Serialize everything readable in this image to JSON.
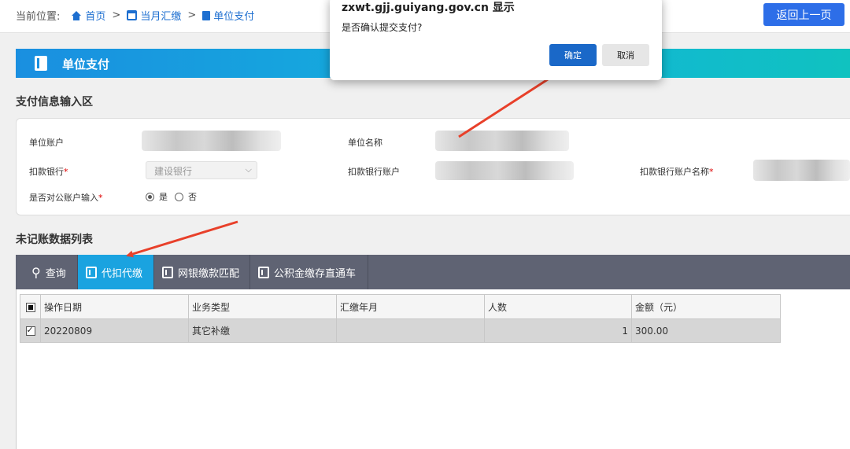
{
  "breadcrumb": {
    "prefix": "当前位置:",
    "home": "首页",
    "monthly": "当月汇缴",
    "current": "单位支付",
    "separator": ">"
  },
  "back_button": "返回上一页",
  "banner_title": "单位支付",
  "payment_section_title": "支付信息输入区",
  "form": {
    "unit_account_label": "单位账户",
    "unit_name_label": "单位名称",
    "deduct_bank_label": "扣款银行",
    "deduct_bank_value": "建设银行",
    "deduct_account_label": "扣款银行账户",
    "deduct_account_name_label": "扣款银行账户名称",
    "public_account_label": "是否对公账户输入",
    "required_mark": "*",
    "option_yes": "是",
    "option_no": "否",
    "public_account_selected": "是"
  },
  "list_section_title": "未记账数据列表",
  "toolbar": {
    "query": "查询",
    "proxy_deduct": "代扣代缴",
    "bank_match": "网银缴款匹配",
    "direct_train": "公积金缴存直通车",
    "active": "代扣代缴"
  },
  "table": {
    "columns": [
      "操作日期",
      "业务类型",
      "汇缴年月",
      "人数",
      "金额（元）"
    ],
    "rows": [
      {
        "checked": true,
        "date": "20220809",
        "type": "其它补缴",
        "month": "",
        "count": "1",
        "amount": "300.00"
      }
    ]
  },
  "dialog": {
    "title": "zxwt.gjj.guiyang.gov.cn 显示",
    "message": "是否确认提交支付?",
    "ok": "确定",
    "cancel": "取消"
  },
  "colors": {
    "accent": "#1a68c8",
    "back_button": "#2d6ee8",
    "toolbar": "#5f6373",
    "toolbar_active": "#1aa3e0",
    "annotation_arrow": "#e8402a"
  }
}
